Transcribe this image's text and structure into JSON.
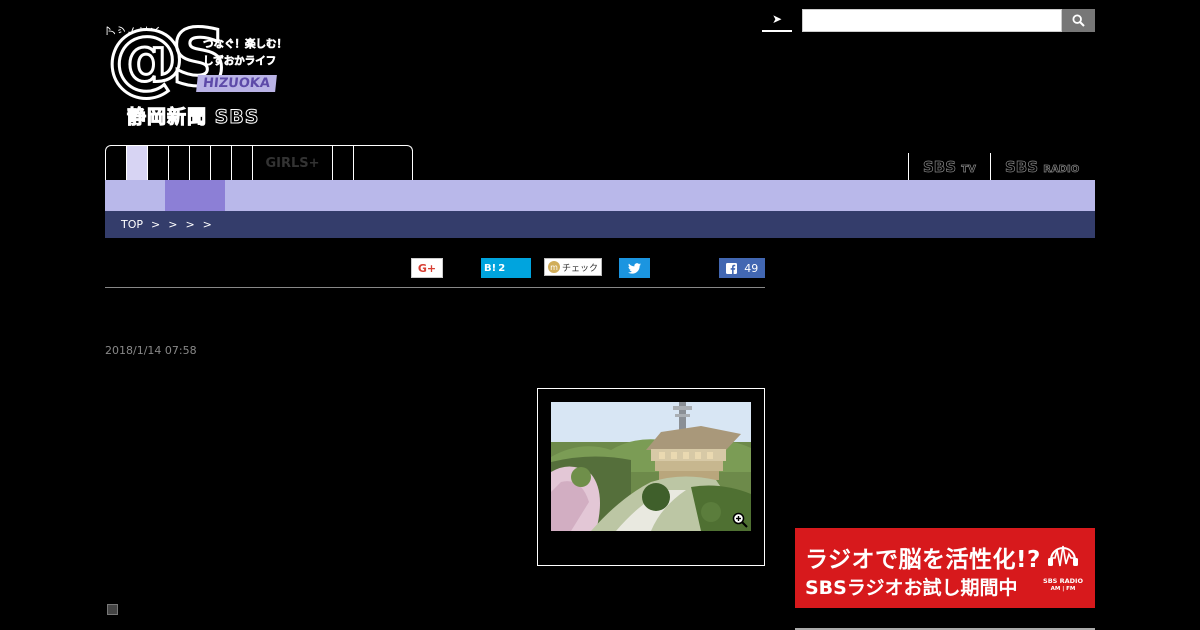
{
  "logo": {
    "kana": "アットエス",
    "mark": "@S",
    "tagline_1": "つなぐ！楽しむ！",
    "tagline_2": "しずおかライフ",
    "region": "HIZUOKA",
    "publisher": "静岡新聞 SBS"
  },
  "search": {
    "arrow_label": "➤",
    "placeholder": "",
    "button_icon": "search-icon"
  },
  "nav": {
    "tabs": [
      "",
      "",
      "",
      "",
      "",
      "",
      "",
      "GIRLS+",
      "",
      ""
    ],
    "active_index": 1
  },
  "broadcast": {
    "tv_main": "SBS",
    "tv_suffix": "TV",
    "radio_main": "SBS",
    "radio_suffix": "RADIO"
  },
  "breadcrumb": {
    "items": [
      "TOP",
      ">",
      ">",
      ">",
      ">"
    ]
  },
  "share": {
    "gplus_label": "G+",
    "hatena_label": "B!",
    "hatena_count": "2",
    "mixi_label": "チェック",
    "mixi_mark": "m",
    "facebook_count": "49"
  },
  "article": {
    "date": "2018/1/14 07:58"
  },
  "ad": {
    "line1": "ラジオで脳を活性化!?",
    "line2": "SBSラジオお試し期間中",
    "logo_brand": "SBS RADIO",
    "logo_freq": "AM | FM"
  },
  "colors": {
    "subnav": "#b9b8ea",
    "subnav_active": "#8c7fd6",
    "breadcrumb_bg": "#343d6b",
    "ad_red": "#d7191c",
    "twitter": "#1b95e0",
    "facebook": "#4267b2",
    "hatena": "#00a4de"
  }
}
